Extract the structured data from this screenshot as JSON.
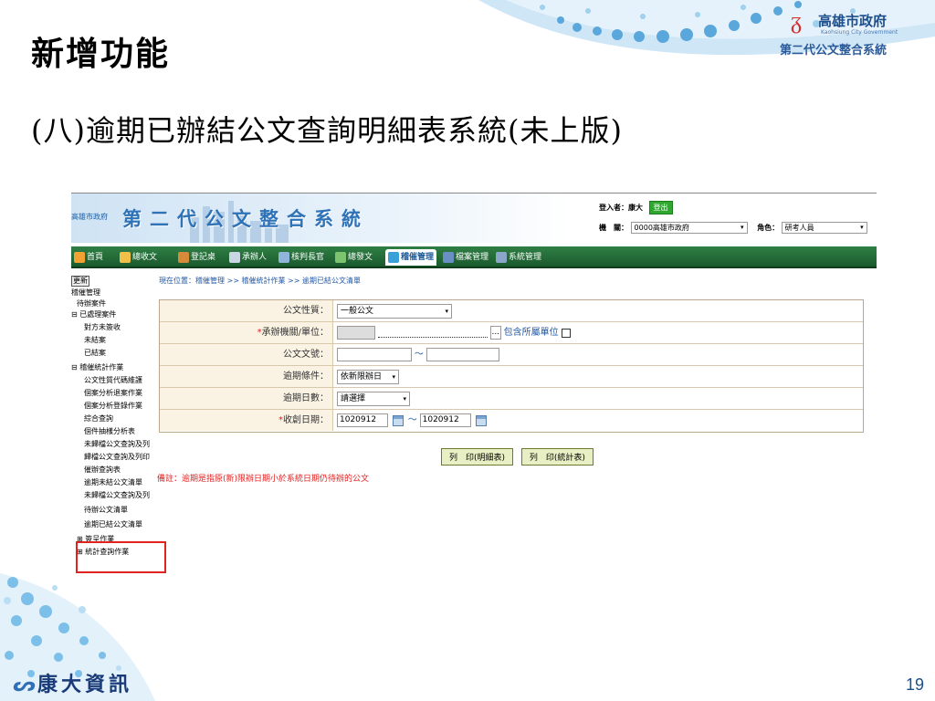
{
  "slide": {
    "title": "新增功能",
    "subtitle": "(八)逾期已辦結公文查詢明細表系統(未上版)",
    "gov_logo": {
      "name": "高雄市政府",
      "sub": "Kaohsiung City Government",
      "system": "第二代公文整合系統"
    },
    "footer_logo": "康大資訊",
    "page_number": "19",
    "colors": {
      "title": "#000000",
      "accent_blue": "#1d4f8c",
      "highlight_red": "#e0231f"
    }
  },
  "app": {
    "logo_small": "高雄市政府",
    "title": "第二代公文整合系統",
    "login_label": "登入者：康大",
    "logout_label": "登出",
    "org_label": "機　關：",
    "org_value": "0000高雄市政府",
    "role_label": "角色：",
    "role_value": "研考人員",
    "nav": [
      {
        "label": "首頁",
        "icon": "home-icon"
      },
      {
        "label": "總收文",
        "icon": "inbox-icon"
      },
      {
        "label": "登記桌",
        "icon": "desk-icon"
      },
      {
        "label": "承辦人",
        "icon": "person-icon"
      },
      {
        "label": "核判長官",
        "icon": "approve-icon"
      },
      {
        "label": "總發文",
        "icon": "outbox-icon"
      },
      {
        "label": "稽催管理",
        "icon": "monitor-icon"
      },
      {
        "label": "檔案管理",
        "icon": "archive-icon"
      },
      {
        "label": "系統管理",
        "icon": "settings-icon"
      }
    ],
    "sidebar": {
      "refresh": "更新",
      "items": [
        "稽催管理",
        "待辦案件",
        "⊟ 已處理案件",
        "對方未簽收",
        "未結案",
        "已結案",
        "⊟ 稽催統計作業",
        "公文性質代碼維護",
        "個案分析退案作業",
        "個案分析登錄作業",
        "綜合查詢",
        "個件抽樣分析表",
        "未歸檔公文查詢及列",
        "歸檔公文查詢及列印",
        "催辦查詢表",
        "逾期未結公文清單",
        "未歸檔公文查詢及列",
        "待辦公文清單",
        "逾期已結公文清單",
        "⊞ 簽呈作業",
        "⊞ 統計查詢作業"
      ]
    },
    "breadcrumb": "現在位置：稽催管理 >> 稽催統計作業 >> 逾期已結公文清單",
    "form": {
      "doc_type": {
        "label": "公文性質：",
        "value": "一般公文"
      },
      "dept": {
        "label": "承辦機關/單位：",
        "browse": "...",
        "include_sub": "包含所屬單位"
      },
      "doc_no": {
        "label": "公文文號：",
        "sep": "～"
      },
      "overdue_cond": {
        "label": "逾期條件：",
        "value": "依新限辦日"
      },
      "overdue_days": {
        "label": "逾期日數：",
        "value": "請選擇"
      },
      "recv_date": {
        "label": "收創日期：",
        "from": "1020912",
        "sep": "～",
        "to": "1020912"
      }
    },
    "buttons": {
      "print_detail": "列　印(明細表)",
      "print_stats": "列　印(統計表)"
    },
    "note": "備註：逾期是指原(新)限辦日期小於系統日期仍待辦的公文"
  }
}
